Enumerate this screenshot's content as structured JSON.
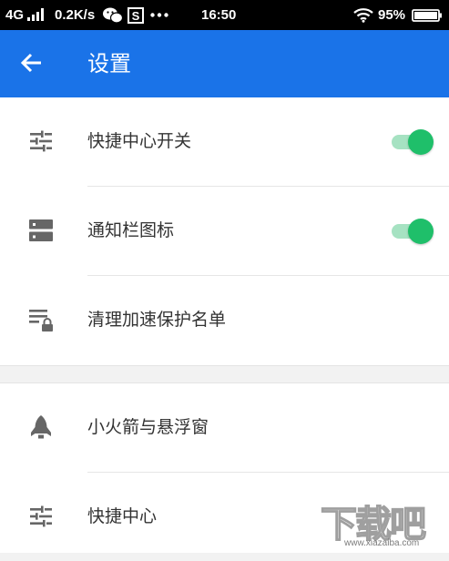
{
  "status_bar": {
    "network": "4G",
    "speed": "0.2K/s",
    "time": "16:50",
    "battery": "95%",
    "icons": [
      "signal-icon",
      "wechat-icon",
      "notification-s-icon",
      "more-dots-icon",
      "wifi-icon",
      "battery-icon"
    ]
  },
  "header": {
    "back_icon": "back-arrow-icon",
    "title": "设置",
    "color": "#1a73e8"
  },
  "sections": [
    {
      "items": [
        {
          "label": "快捷中心开关",
          "icon": "sliders-icon",
          "toggle": true
        },
        {
          "label": "通知栏图标",
          "icon": "server-stack-icon",
          "toggle": true
        },
        {
          "label": "清理加速保护名单",
          "icon": "list-lock-icon"
        }
      ]
    },
    {
      "items": [
        {
          "label": "小火箭与悬浮窗",
          "icon": "rocket-icon"
        },
        {
          "label": "快捷中心",
          "icon": "sliders-icon"
        }
      ]
    }
  ],
  "toggle_colors": {
    "knob": "#1fbf6a",
    "track": "#a6e2c2"
  },
  "watermark": {
    "text": "下载吧",
    "url": "www.xiazaiba.com"
  }
}
